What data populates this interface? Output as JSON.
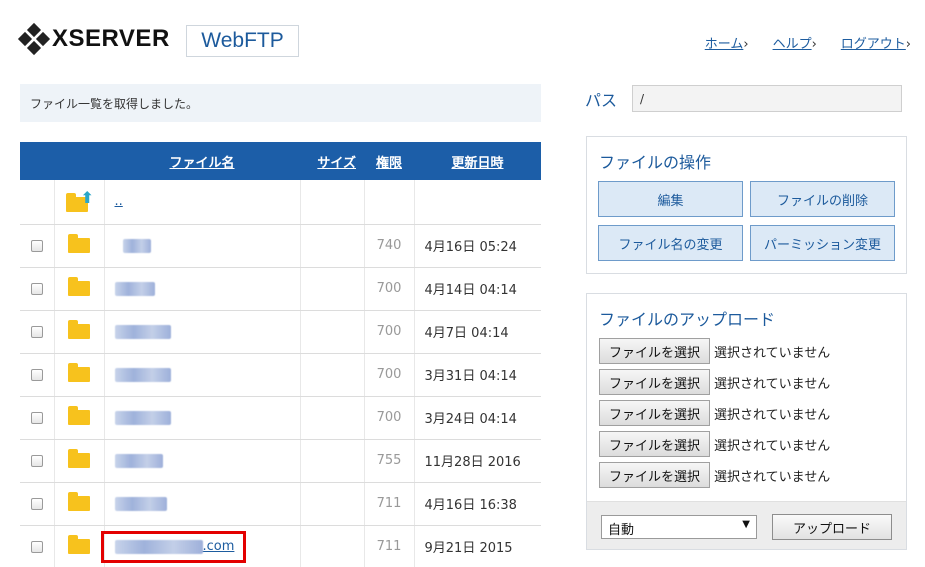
{
  "header": {
    "brand": "XSERVER",
    "product": "WebFTP",
    "links": [
      {
        "label": "ホーム"
      },
      {
        "label": "ヘルプ"
      },
      {
        "label": "ログアウト"
      }
    ]
  },
  "message": "ファイル一覧を取得しました。",
  "table": {
    "columns": [
      "ファイル名",
      "サイズ",
      "権限",
      "更新日時"
    ],
    "up_label": "..",
    "rows": [
      {
        "name": "",
        "size": "",
        "perm": "740",
        "date": "4月16日 05:24"
      },
      {
        "name": "",
        "size": "",
        "perm": "700",
        "date": "4月14日 04:14"
      },
      {
        "name": "",
        "size": "",
        "perm": "700",
        "date": "4月7日 04:14"
      },
      {
        "name": "",
        "size": "",
        "perm": "700",
        "date": "3月31日 04:14"
      },
      {
        "name": "",
        "size": "",
        "perm": "700",
        "date": "3月24日 04:14"
      },
      {
        "name": "",
        "size": "",
        "perm": "755",
        "date": "11月28日 2016"
      },
      {
        "name": "",
        "size": "",
        "perm": "711",
        "date": "4月16日 16:38"
      },
      {
        "name": ".com",
        "size": "",
        "perm": "711",
        "date": "9月21日 2015"
      }
    ]
  },
  "path": {
    "label": "パス",
    "value": "/"
  },
  "operations": {
    "title": "ファイルの操作",
    "edit": "編集",
    "delete": "ファイルの削除",
    "rename": "ファイル名の変更",
    "permission": "パーミッション変更"
  },
  "upload": {
    "title": "ファイルのアップロード",
    "choose_label": "ファイルを選択",
    "none_label": "選択されていません",
    "encoding": "自動",
    "upload_button": "アップロード"
  },
  "colors": {
    "accent": "#1c5ea8",
    "highlight": "#e30000",
    "folder": "#f7c21d"
  }
}
